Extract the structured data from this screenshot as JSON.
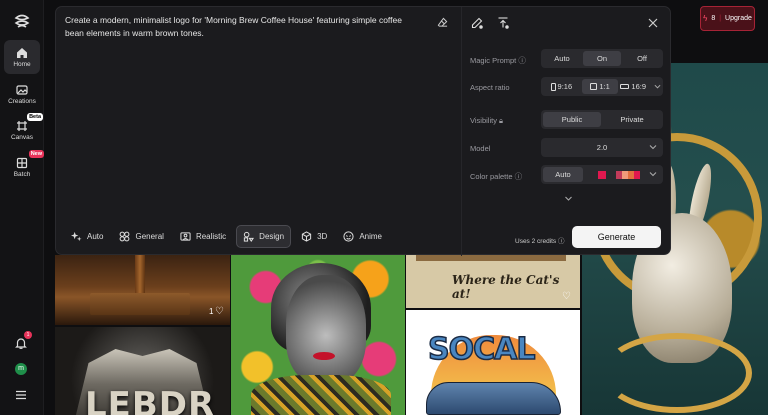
{
  "sidebar": {
    "items": [
      {
        "label": "Home",
        "icon": "home-icon"
      },
      {
        "label": "Creations",
        "icon": "image-icon"
      },
      {
        "label": "Canvas",
        "icon": "canvas-icon",
        "badge": "Beta"
      },
      {
        "label": "Batch",
        "icon": "grid-icon",
        "badge": "New"
      }
    ],
    "notification_count": "1",
    "avatar_initial": "m"
  },
  "header": {
    "credits": "8",
    "upgrade_label": "Upgrade"
  },
  "prompt": {
    "text": "Create a modern, minimalist logo for 'Morning Brew Coffee House' featuring simple coffee bean elements in warm brown tones."
  },
  "styles": [
    {
      "label": "Auto",
      "icon": "sparkle-icon",
      "active": false
    },
    {
      "label": "General",
      "icon": "clover-icon",
      "active": false
    },
    {
      "label": "Realistic",
      "icon": "photo-icon",
      "active": false
    },
    {
      "label": "Design",
      "icon": "palette-icon",
      "active": true
    },
    {
      "label": "3D",
      "icon": "cube-icon",
      "active": false
    },
    {
      "label": "Anime",
      "icon": "face-icon",
      "active": false
    }
  ],
  "settings": {
    "magic_prompt": {
      "label": "Magic Prompt",
      "options": [
        "Auto",
        "On",
        "Off"
      ],
      "selected": "On"
    },
    "aspect_ratio": {
      "label": "Aspect ratio",
      "options": [
        "9:16",
        "1:1",
        "16:9"
      ],
      "selected": "1:1"
    },
    "visibility": {
      "label": "Visibility",
      "options": [
        "Public",
        "Private"
      ],
      "selected": "Public"
    },
    "model": {
      "label": "Model",
      "value": "2.0"
    },
    "color_palette": {
      "label": "Color palette",
      "value": "Auto",
      "swatches": [
        "#e0184f",
        "#f09a7a",
        "#e2703f",
        "#c23b5a"
      ]
    }
  },
  "footer": {
    "credits_text": "Uses 2 credits",
    "generate_label": "Generate"
  },
  "gallery": {
    "like_count": "1",
    "tile_text_cat": "Where the Cat's at!",
    "tile_text_socal": "SOCAL",
    "tile_text_shield": "LEBDR"
  },
  "colors": {
    "accent": "#e8335a",
    "panel": "#1b1b1e",
    "background": "#0e0e10"
  }
}
